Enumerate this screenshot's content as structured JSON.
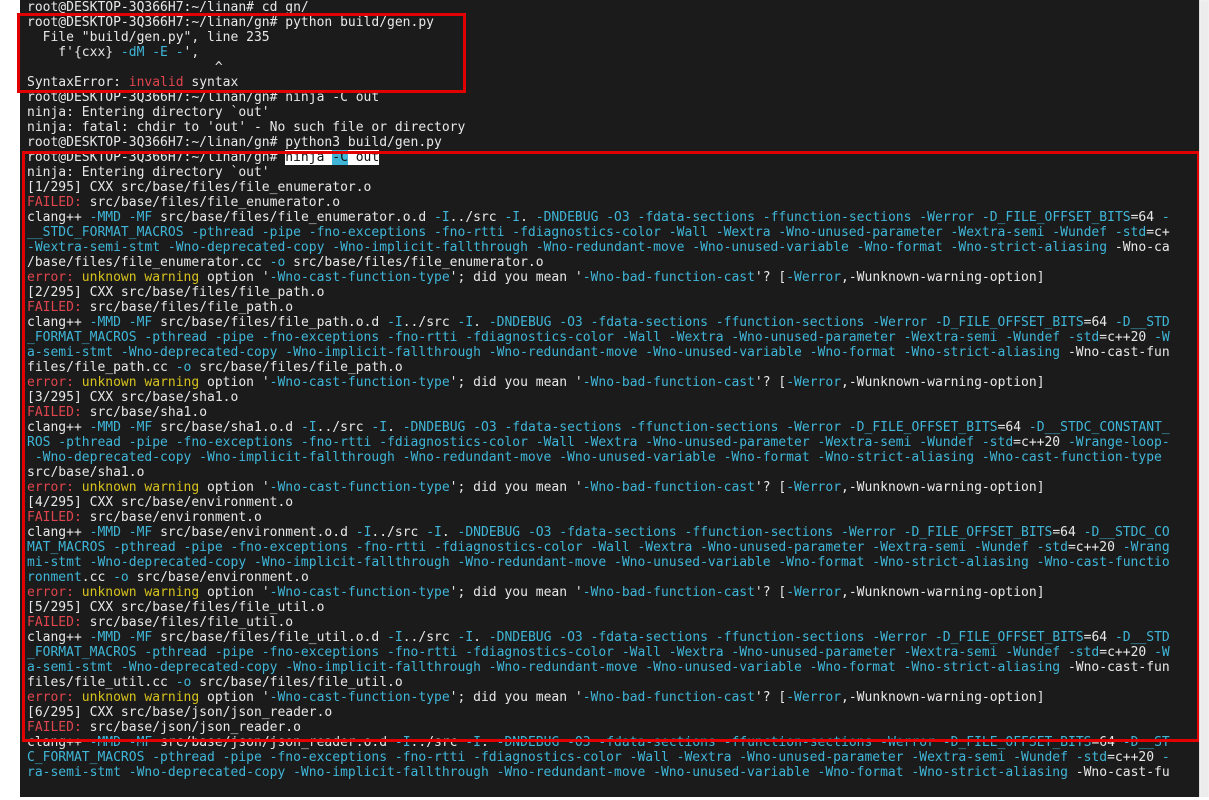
{
  "terminal": {
    "lines": [
      [
        {
          "t": "root@DESKTOP-3Q366H7:~/linan# cd gn/",
          "c": "w"
        }
      ],
      [
        {
          "t": "root@DESKTOP-3Q366H7:~/linan/gn# python build/gen.py",
          "c": "w"
        }
      ],
      [
        {
          "t": "  File \"build/gen.py\", line 235",
          "c": "w"
        }
      ],
      [
        {
          "t": "    f'{cxx} ",
          "c": "w"
        },
        {
          "t": "-dM",
          "c": "c"
        },
        {
          "t": " ",
          "c": "w"
        },
        {
          "t": "-E",
          "c": "c"
        },
        {
          "t": " ",
          "c": "w"
        },
        {
          "t": "-",
          "c": "c"
        },
        {
          "t": "',",
          "c": "w"
        }
      ],
      [
        {
          "t": "                        ^",
          "c": "w"
        }
      ],
      [
        {
          "t": "SyntaxError: ",
          "c": "w"
        },
        {
          "t": "invalid",
          "c": "r"
        },
        {
          "t": " syntax",
          "c": "w"
        }
      ],
      [
        {
          "t": "root@DESKTOP-3Q366H7:~/linan/gn# ninja -C out",
          "c": "w"
        }
      ],
      [
        {
          "t": "ninja: Entering directory `out'",
          "c": "w"
        }
      ],
      [
        {
          "t": "ninja: fatal: chdir to 'out' - No such file or directory",
          "c": "w"
        }
      ],
      [
        {
          "t": "root@DESKTOP-3Q366H7:~/linan/gn# python3 build/gen.py",
          "c": "w"
        }
      ],
      [
        {
          "t": "root@DESKTOP-3Q366H7:~/linan/gn# ",
          "c": "w"
        },
        {
          "t": "ninja ",
          "c": "hl"
        },
        {
          "t": "-C",
          "c": "hlc"
        },
        {
          "t": " out",
          "c": "hl"
        }
      ],
      [
        {
          "t": "ninja: Entering directory `out'",
          "c": "w"
        }
      ],
      [
        {
          "t": "[1/295] CXX src/base/files/file_enumerator.o",
          "c": "w"
        }
      ],
      [
        {
          "t": "FAILED:",
          "c": "r"
        },
        {
          "t": " src/base/files/file_enumerator.o",
          "c": "w"
        }
      ],
      [
        {
          "t": "clang++ ",
          "c": "w"
        },
        {
          "t": "-MMD -MF",
          "c": "c"
        },
        {
          "t": " src/base/files/file_enumerator.o.d ",
          "c": "w"
        },
        {
          "t": "-I",
          "c": "c"
        },
        {
          "t": "../src ",
          "c": "w"
        },
        {
          "t": "-I",
          "c": "c"
        },
        {
          "t": ". ",
          "c": "w"
        },
        {
          "t": "-DNDEBUG -O3 -fdata-sections -ffunction-sections -Werror -D_FILE_OFFSET_BITS",
          "c": "c"
        },
        {
          "t": "=64 ",
          "c": "w"
        },
        {
          "t": "-",
          "c": "c"
        }
      ],
      [
        {
          "t": "__STDC_FORMAT_MACROS -pthread -pipe -fno-exceptions -fno-rtti -fdiagnostics-color -Wall -Wextra -Wno-unused-parameter -Wextra-semi -Wundef -std",
          "c": "c"
        },
        {
          "t": "=c+",
          "c": "w"
        }
      ],
      [
        {
          "t": "-Wextra-semi-stmt -Wno-deprecated-copy -Wno-implicit-fallthrough -Wno-redundant-move -Wno-unused-variable -Wno-format -Wno-strict-aliasing ",
          "c": "c"
        },
        {
          "t": "-Wno-ca",
          "c": "w"
        }
      ],
      [
        {
          "t": "/base/files/file_enumerator.cc ",
          "c": "w"
        },
        {
          "t": "-o",
          "c": "c"
        },
        {
          "t": " src/base/files/file_enumerator.o",
          "c": "w"
        }
      ],
      [
        {
          "t": "error: ",
          "c": "r"
        },
        {
          "t": "unknown warning",
          "c": "y"
        },
        {
          "t": " option '",
          "c": "w"
        },
        {
          "t": "-Wno-cast-function-type",
          "c": "c"
        },
        {
          "t": "'; did you mean '",
          "c": "w"
        },
        {
          "t": "-Wno-bad-function-cast",
          "c": "c"
        },
        {
          "t": "'? [",
          "c": "w"
        },
        {
          "t": "-Werror",
          "c": "c"
        },
        {
          "t": ",-Wunknown-warning-option]",
          "c": "w"
        }
      ],
      [
        {
          "t": "[2/295] CXX src/base/files/file_path.o",
          "c": "w"
        }
      ],
      [
        {
          "t": "FAILED:",
          "c": "r"
        },
        {
          "t": " src/base/files/file_path.o",
          "c": "w"
        }
      ],
      [
        {
          "t": "clang++ ",
          "c": "w"
        },
        {
          "t": "-MMD -MF",
          "c": "c"
        },
        {
          "t": " src/base/files/file_path.o.d ",
          "c": "w"
        },
        {
          "t": "-I",
          "c": "c"
        },
        {
          "t": "../src ",
          "c": "w"
        },
        {
          "t": "-I",
          "c": "c"
        },
        {
          "t": ". ",
          "c": "w"
        },
        {
          "t": "-DNDEBUG -O3 -fdata-sections -ffunction-sections -Werror -D_FILE_OFFSET_BITS",
          "c": "c"
        },
        {
          "t": "=64 ",
          "c": "w"
        },
        {
          "t": "-D__STD",
          "c": "c"
        }
      ],
      [
        {
          "t": "_FORMAT_MACROS -pthread -pipe -fno-exceptions -fno-rtti -fdiagnostics-color -Wall -Wextra -Wno-unused-parameter -Wextra-semi -Wundef -std",
          "c": "c"
        },
        {
          "t": "=c++20 ",
          "c": "w"
        },
        {
          "t": "-W",
          "c": "c"
        }
      ],
      [
        {
          "t": "a-semi-stmt -Wno-deprecated-copy -Wno-implicit-fallthrough -Wno-redundant-move -Wno-unused-variable -Wno-format -Wno-strict-aliasing ",
          "c": "c"
        },
        {
          "t": "-Wno-cast-fun",
          "c": "w"
        }
      ],
      [
        {
          "t": "files/file_path.cc ",
          "c": "w"
        },
        {
          "t": "-o",
          "c": "c"
        },
        {
          "t": " src/base/files/file_path.o",
          "c": "w"
        }
      ],
      [
        {
          "t": "error: ",
          "c": "r"
        },
        {
          "t": "unknown warning",
          "c": "y"
        },
        {
          "t": " option '",
          "c": "w"
        },
        {
          "t": "-Wno-cast-function-type",
          "c": "c"
        },
        {
          "t": "'; did you mean '",
          "c": "w"
        },
        {
          "t": "-Wno-bad-function-cast",
          "c": "c"
        },
        {
          "t": "'? [",
          "c": "w"
        },
        {
          "t": "-Werror",
          "c": "c"
        },
        {
          "t": ",-Wunknown-warning-option]",
          "c": "w"
        }
      ],
      [
        {
          "t": "[3/295] CXX src/base/sha1.o",
          "c": "w"
        }
      ],
      [
        {
          "t": "FAILED:",
          "c": "r"
        },
        {
          "t": " src/base/sha1.o",
          "c": "w"
        }
      ],
      [
        {
          "t": "clang++ ",
          "c": "w"
        },
        {
          "t": "-MMD -MF",
          "c": "c"
        },
        {
          "t": " src/base/sha1.o.d ",
          "c": "w"
        },
        {
          "t": "-I",
          "c": "c"
        },
        {
          "t": "../src ",
          "c": "w"
        },
        {
          "t": "-I",
          "c": "c"
        },
        {
          "t": ". ",
          "c": "w"
        },
        {
          "t": "-DNDEBUG -O3 -fdata-sections -ffunction-sections -Werror -D_FILE_OFFSET_BITS",
          "c": "c"
        },
        {
          "t": "=64 ",
          "c": "w"
        },
        {
          "t": "-D__STDC_CONSTANT_",
          "c": "c"
        }
      ],
      [
        {
          "t": "ROS -pthread -pipe -fno-exceptions -fno-rtti -fdiagnostics-color -Wall -Wextra -Wno-unused-parameter -Wextra-semi -Wundef -std",
          "c": "c"
        },
        {
          "t": "=c++20 ",
          "c": "w"
        },
        {
          "t": "-Wrange-loop-",
          "c": "c"
        }
      ],
      [
        {
          "t": " -Wno-deprecated-copy -Wno-implicit-fallthrough -Wno-redundant-move -Wno-unused-variable -Wno-format -Wno-strict-aliasing -Wno-cast-function-type",
          "c": "c"
        }
      ],
      [
        {
          "t": "src/base/sha1.o",
          "c": "w"
        }
      ],
      [
        {
          "t": "error: ",
          "c": "r"
        },
        {
          "t": "unknown warning",
          "c": "y"
        },
        {
          "t": " option '",
          "c": "w"
        },
        {
          "t": "-Wno-cast-function-type",
          "c": "c"
        },
        {
          "t": "'; did you mean '",
          "c": "w"
        },
        {
          "t": "-Wno-bad-function-cast",
          "c": "c"
        },
        {
          "t": "'? [",
          "c": "w"
        },
        {
          "t": "-Werror",
          "c": "c"
        },
        {
          "t": ",-Wunknown-warning-option]",
          "c": "w"
        }
      ],
      [
        {
          "t": "[4/295] CXX src/base/environment.o",
          "c": "w"
        }
      ],
      [
        {
          "t": "FAILED:",
          "c": "r"
        },
        {
          "t": " src/base/environment.o",
          "c": "w"
        }
      ],
      [
        {
          "t": "clang++ ",
          "c": "w"
        },
        {
          "t": "-MMD -MF",
          "c": "c"
        },
        {
          "t": " src/base/environment.o.d ",
          "c": "w"
        },
        {
          "t": "-I",
          "c": "c"
        },
        {
          "t": "../src ",
          "c": "w"
        },
        {
          "t": "-I",
          "c": "c"
        },
        {
          "t": ". ",
          "c": "w"
        },
        {
          "t": "-DNDEBUG -O3 -fdata-sections -ffunction-sections -Werror -D_FILE_OFFSET_BITS",
          "c": "c"
        },
        {
          "t": "=64 ",
          "c": "w"
        },
        {
          "t": "-D__STDC_CO",
          "c": "c"
        }
      ],
      [
        {
          "t": "MAT_MACROS -pthread -pipe -fno-exceptions -fno-rtti -fdiagnostics-color -Wall -Wextra -Wno-unused-parameter -Wextra-semi -Wundef -std",
          "c": "c"
        },
        {
          "t": "=c++20 ",
          "c": "w"
        },
        {
          "t": "-Wrang",
          "c": "c"
        }
      ],
      [
        {
          "t": "mi-stmt -Wno-deprecated-copy -Wno-implicit-fallthrough -Wno-redundant-move -Wno-unused-variable -Wno-format -Wno-strict-aliasing -Wno-cast-functio",
          "c": "c"
        }
      ],
      [
        {
          "t": "ronment",
          "c": "c"
        },
        {
          "t": ".cc ",
          "c": "w"
        },
        {
          "t": "-o",
          "c": "c"
        },
        {
          "t": " src/base/environment.o",
          "c": "w"
        }
      ],
      [
        {
          "t": "error: ",
          "c": "r"
        },
        {
          "t": "unknown warning",
          "c": "y"
        },
        {
          "t": " option '",
          "c": "w"
        },
        {
          "t": "-Wno-cast-function-type",
          "c": "c"
        },
        {
          "t": "'; did you mean '",
          "c": "w"
        },
        {
          "t": "-Wno-bad-function-cast",
          "c": "c"
        },
        {
          "t": "'? [",
          "c": "w"
        },
        {
          "t": "-Werror",
          "c": "c"
        },
        {
          "t": ",-Wunknown-warning-option]",
          "c": "w"
        }
      ],
      [
        {
          "t": "[5/295] CXX src/base/files/file_util.o",
          "c": "w"
        }
      ],
      [
        {
          "t": "FAILED:",
          "c": "r"
        },
        {
          "t": " src/base/files/file_util.o",
          "c": "w"
        }
      ],
      [
        {
          "t": "clang++ ",
          "c": "w"
        },
        {
          "t": "-MMD -MF",
          "c": "c"
        },
        {
          "t": " src/base/files/file_util.o.d ",
          "c": "w"
        },
        {
          "t": "-I",
          "c": "c"
        },
        {
          "t": "../src ",
          "c": "w"
        },
        {
          "t": "-I",
          "c": "c"
        },
        {
          "t": ". ",
          "c": "w"
        },
        {
          "t": "-DNDEBUG -O3 -fdata-sections -ffunction-sections -Werror -D_FILE_OFFSET_BITS",
          "c": "c"
        },
        {
          "t": "=64 ",
          "c": "w"
        },
        {
          "t": "-D__STD",
          "c": "c"
        }
      ],
      [
        {
          "t": "_FORMAT_MACROS -pthread -pipe -fno-exceptions -fno-rtti -fdiagnostics-color -Wall -Wextra -Wno-unused-parameter -Wextra-semi -Wundef -std",
          "c": "c"
        },
        {
          "t": "=c++20 ",
          "c": "w"
        },
        {
          "t": "-W",
          "c": "c"
        }
      ],
      [
        {
          "t": "a-semi-stmt -Wno-deprecated-copy -Wno-implicit-fallthrough -Wno-redundant-move -Wno-unused-variable -Wno-format -Wno-strict-aliasing ",
          "c": "c"
        },
        {
          "t": "-Wno-cast-fun",
          "c": "w"
        }
      ],
      [
        {
          "t": "files/file_util.cc ",
          "c": "w"
        },
        {
          "t": "-o",
          "c": "c"
        },
        {
          "t": " src/base/files/file_util.o",
          "c": "w"
        }
      ],
      [
        {
          "t": "error: ",
          "c": "r"
        },
        {
          "t": "unknown warning",
          "c": "y"
        },
        {
          "t": " option '",
          "c": "w"
        },
        {
          "t": "-Wno-cast-function-type",
          "c": "c"
        },
        {
          "t": "'; did you mean '",
          "c": "w"
        },
        {
          "t": "-Wno-bad-function-cast",
          "c": "c"
        },
        {
          "t": "'? [",
          "c": "w"
        },
        {
          "t": "-Werror",
          "c": "c"
        },
        {
          "t": ",-Wunknown-warning-option]",
          "c": "w"
        }
      ],
      [
        {
          "t": "[6/295] CXX src/base/json/json_reader.o",
          "c": "w"
        }
      ],
      [
        {
          "t": "FAILED:",
          "c": "r"
        },
        {
          "t": " src/base/json/json_reader.o",
          "c": "w"
        }
      ],
      [
        {
          "t": "clang++ ",
          "c": "w"
        },
        {
          "t": "-MMD -MF",
          "c": "c"
        },
        {
          "t": " src/base/json/json_reader.o.d ",
          "c": "w"
        },
        {
          "t": "-I",
          "c": "c"
        },
        {
          "t": "../src ",
          "c": "w"
        },
        {
          "t": "-I",
          "c": "c"
        },
        {
          "t": ". ",
          "c": "w"
        },
        {
          "t": "-DNDEBUG -O3 -fdata-sections -ffunction-sections -Werror -D_FILE_OFFSET_BITS",
          "c": "c"
        },
        {
          "t": "=64 ",
          "c": "w"
        },
        {
          "t": "-D__ST",
          "c": "c"
        }
      ],
      [
        {
          "t": "C_FORMAT_MACROS -pthread -pipe -fno-exceptions -fno-rtti -fdiagnostics-color -Wall -Wextra -Wno-unused-parameter -Wextra-semi -Wundef -std",
          "c": "c"
        },
        {
          "t": "=c++20 ",
          "c": "w"
        },
        {
          "t": "-",
          "c": "c"
        }
      ],
      [
        {
          "t": "ra-semi-stmt -Wno-deprecated-copy -Wno-implicit-fallthrough -Wno-redundant-move -Wno-unused-variable -Wno-format -Wno-strict-aliasing ",
          "c": "c"
        },
        {
          "t": "-Wno-cast-fu",
          "c": "w"
        }
      ]
    ]
  },
  "colors": {
    "background": "#1b1b1b",
    "text": "#e8e8e8",
    "cyan": "#3fb6d8",
    "red": "#e0454d",
    "yellow": "#d6c21e",
    "annotation": "#e30000"
  }
}
